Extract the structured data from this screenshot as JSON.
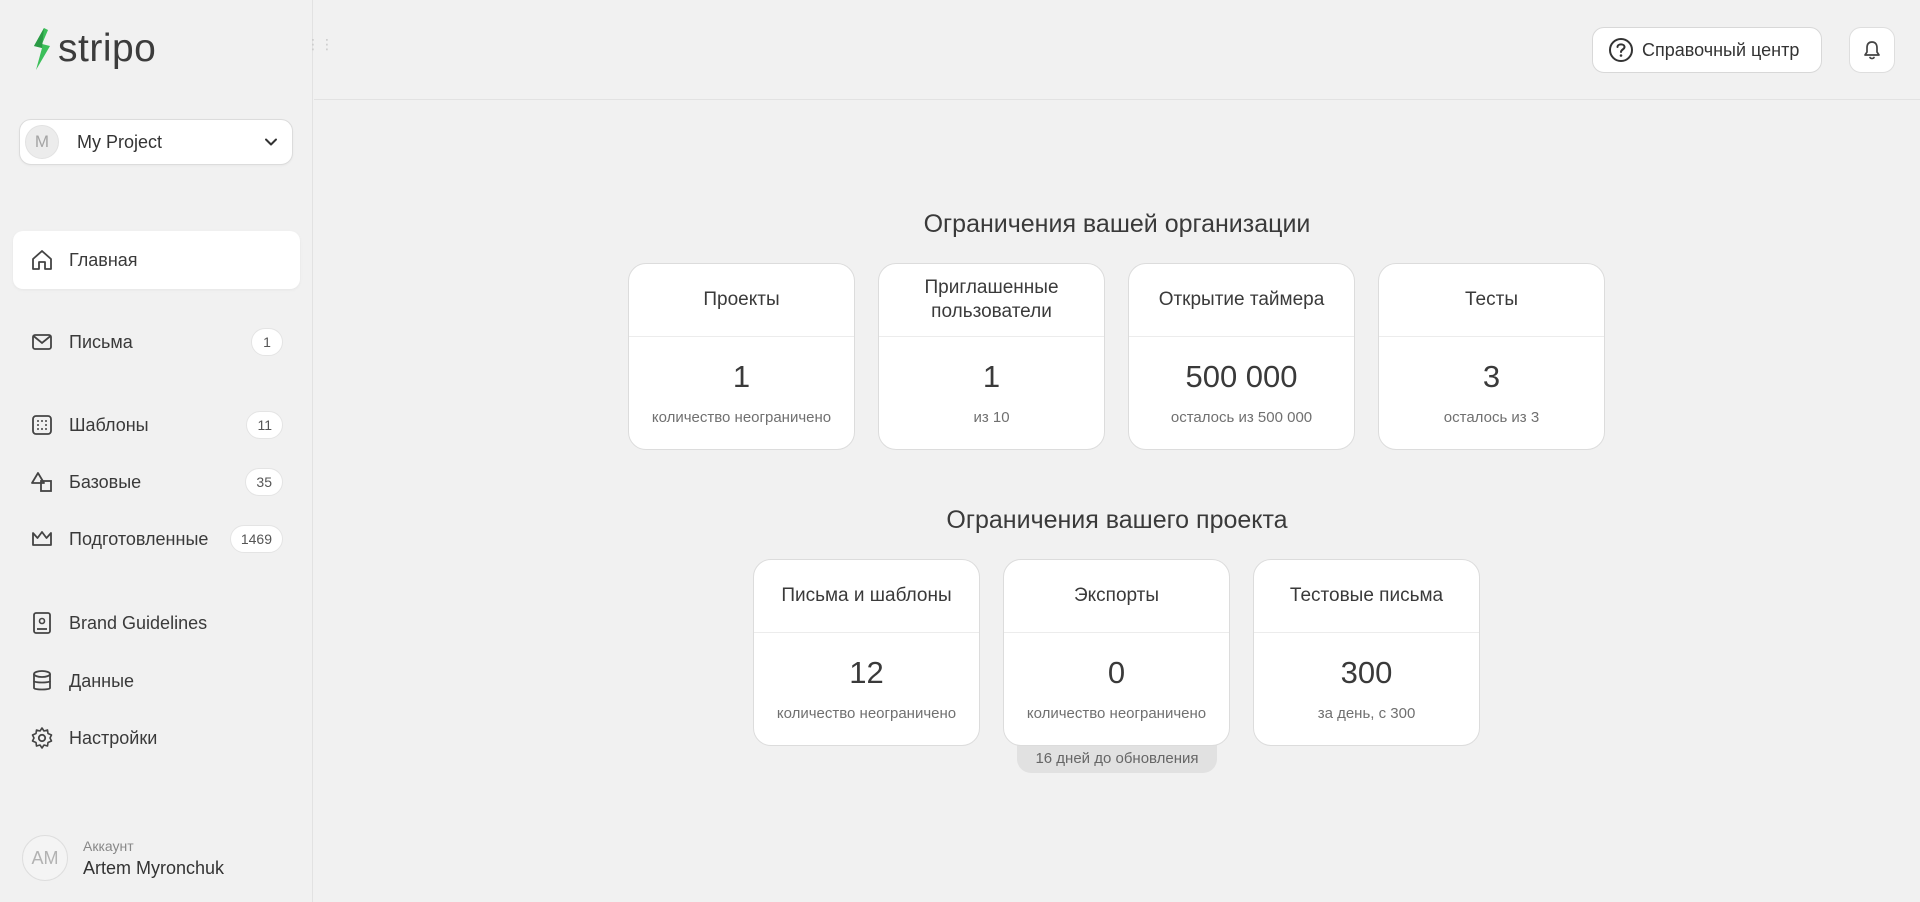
{
  "app": {
    "logo_text": "stripo"
  },
  "project_select": {
    "avatar_letter": "M",
    "name": "My Project"
  },
  "sidebar": {
    "items": [
      {
        "label": "Главная",
        "icon": "home-icon",
        "badge": ""
      },
      {
        "label": "Письма",
        "icon": "mail-icon",
        "badge": "1"
      },
      {
        "label": "Шаблоны",
        "icon": "templates-icon",
        "badge": "11"
      },
      {
        "label": "Базовые",
        "icon": "shapes-icon",
        "badge": "35"
      },
      {
        "label": "Подготовленные",
        "icon": "crown-icon",
        "badge": "1469"
      },
      {
        "label": "Brand Guidelines",
        "icon": "brand-book-icon",
        "badge": ""
      },
      {
        "label": "Данные",
        "icon": "database-icon",
        "badge": ""
      },
      {
        "label": "Настройки",
        "icon": "gear-icon",
        "badge": ""
      }
    ]
  },
  "account": {
    "avatar_initials": "AM",
    "caption": "Аккаунт",
    "name": "Artem Myronchuk"
  },
  "header": {
    "help_label": "Справочный центр"
  },
  "org_limits": {
    "title": "Ограничения вашей организации",
    "cards": [
      {
        "title": "Проекты",
        "value": "1",
        "sub": "количество неограничено"
      },
      {
        "title": "Приглашенные пользователи",
        "value": "1",
        "sub": "из 10"
      },
      {
        "title": "Открытие таймера",
        "value": "500 000",
        "sub": "осталось из 500 000"
      },
      {
        "title": "Тесты",
        "value": "3",
        "sub": "осталось из 3"
      }
    ]
  },
  "project_limits": {
    "title": "Ограничения вашего проекта",
    "cards": [
      {
        "title": "Письма и шаблоны",
        "value": "12",
        "sub": "количество неограничено"
      },
      {
        "title": "Экспорты",
        "value": "0",
        "sub": "количество неограничено"
      },
      {
        "title": "Тестовые письма",
        "value": "300",
        "sub": "за день, с 300"
      }
    ],
    "update_note": "16 дней до обновления"
  },
  "colors": {
    "brand_green": "#3cbf5a",
    "background": "#f1f1f1"
  }
}
